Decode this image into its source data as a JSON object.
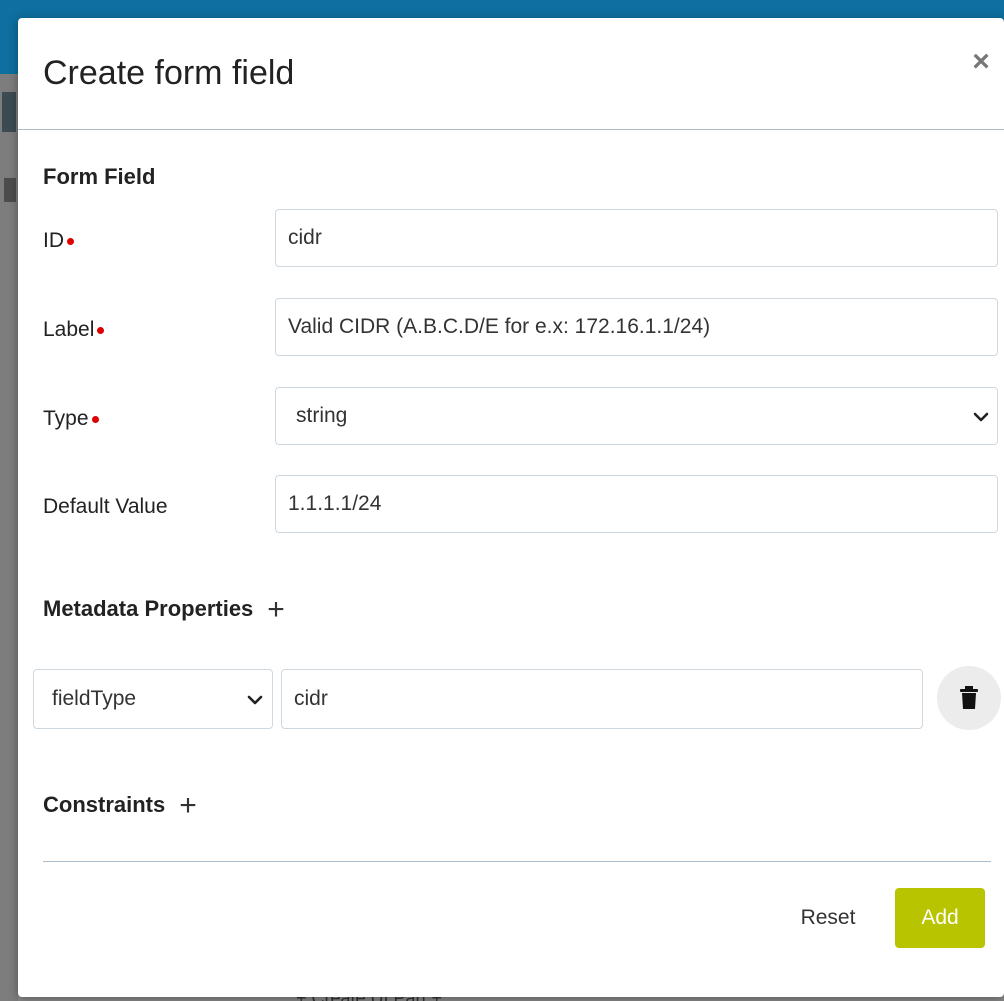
{
  "background": {
    "partial_text": "+ Create UI Part +"
  },
  "modal": {
    "title": "Create form field",
    "close_label": "×"
  },
  "form_field": {
    "section_title": "Form Field",
    "id": {
      "label": "ID",
      "required": true,
      "value": "cidr"
    },
    "label": {
      "label": "Label",
      "required": true,
      "value": "Valid CIDR (A.B.C.D/E for e.x: 172.16.1.1/24)"
    },
    "type": {
      "label": "Type",
      "required": true,
      "value": "string"
    },
    "default_value": {
      "label": "Default Value",
      "value": "1.1.1.1/24"
    }
  },
  "metadata": {
    "section_title": "Metadata Properties",
    "rows": [
      {
        "key": "fieldType",
        "value": "cidr"
      }
    ]
  },
  "constraints": {
    "section_title": "Constraints"
  },
  "footer": {
    "reset_label": "Reset",
    "add_label": "Add"
  },
  "colors": {
    "accent": "#b9c400",
    "required": "#dd0000",
    "topbar": "#0e6fa0"
  }
}
